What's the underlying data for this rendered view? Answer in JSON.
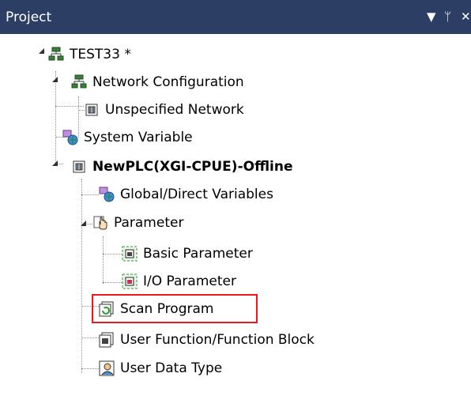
{
  "panel": {
    "title": "Project",
    "dropdown_glyph": "▼",
    "pin_glyph": "ᚔ",
    "close_glyph": "✕",
    "titlebar_color": "#2c3e63",
    "highlight_color": "#e8181e"
  },
  "tree": {
    "project": "TEST33 *",
    "network_config": "Network Configuration",
    "unspecified_network": "Unspecified Network",
    "system_variable": "System Variable",
    "plc": "NewPLC(XGI-CPUE)-Offline",
    "global_vars": "Global/Direct Variables",
    "parameter": "Parameter",
    "basic_parameter": "Basic Parameter",
    "io_parameter": "I/O Parameter",
    "scan_program": "Scan Program",
    "user_function": "User Function/Function Block",
    "user_data_type": "User Data Type"
  },
  "icons": {
    "project": "network-project-icon",
    "network_config": "network-config-icon",
    "unspecified_network": "network-node-icon",
    "system_variable": "system-variable-icon",
    "plc": "plc-icon",
    "global_vars": "global-variables-icon",
    "parameter": "parameter-hand-icon",
    "basic_parameter": "basic-parameter-icon",
    "io_parameter": "io-parameter-icon",
    "scan_program": "scan-program-icon",
    "user_function": "user-function-icon",
    "user_data_type": "user-data-type-icon"
  }
}
